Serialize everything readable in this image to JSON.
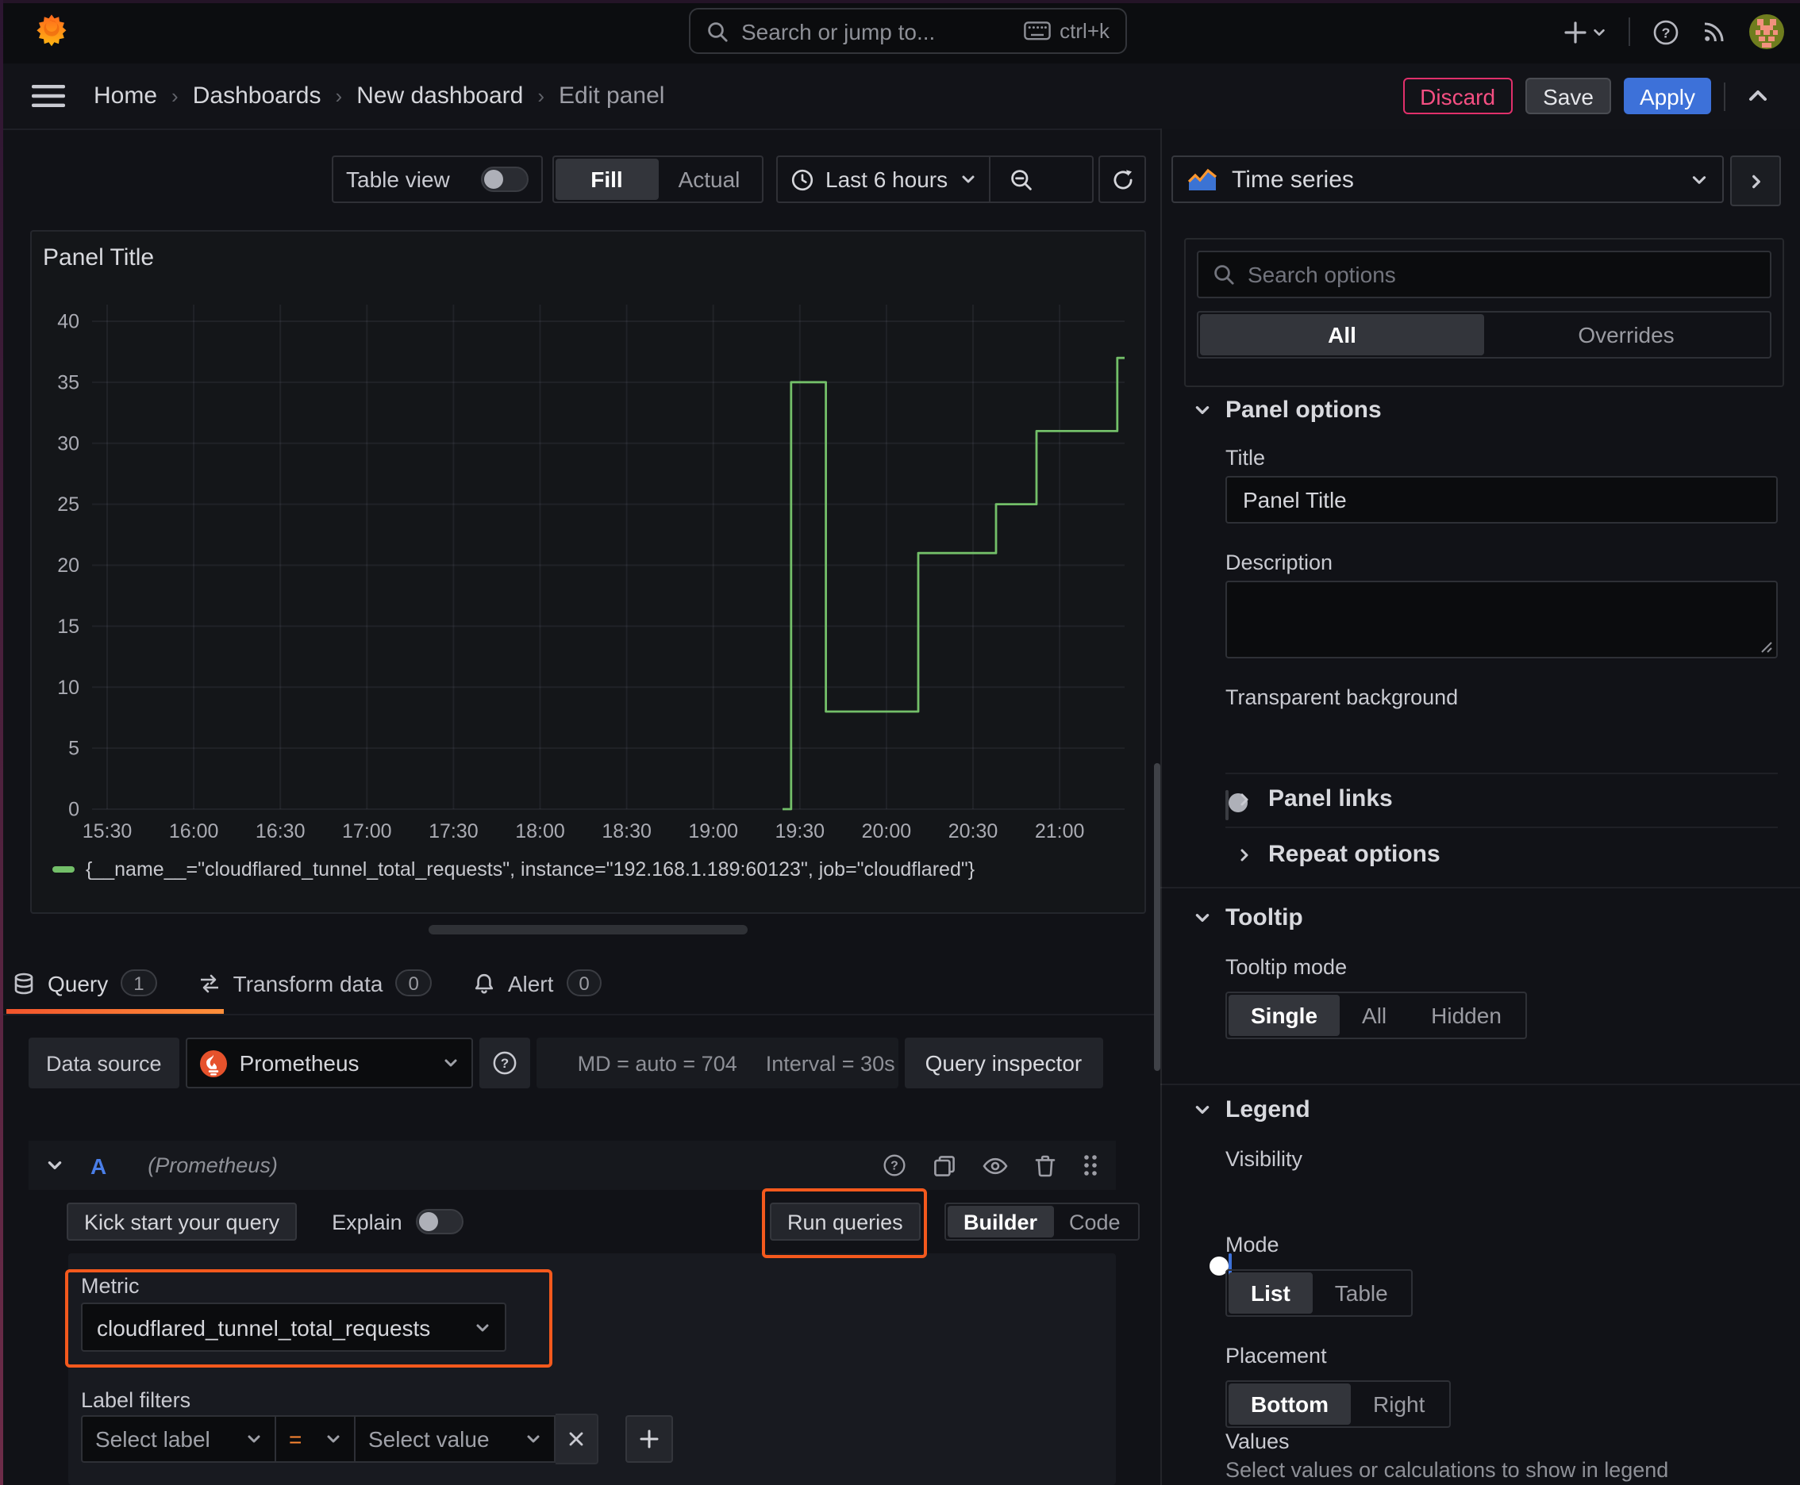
{
  "header": {
    "search_placeholder": "Search or jump to...",
    "search_shortcut": "ctrl+k"
  },
  "breadcrumb": {
    "items": [
      "Home",
      "Dashboards",
      "New dashboard",
      "Edit panel"
    ],
    "discard": "Discard",
    "save": "Save",
    "apply": "Apply"
  },
  "toolbar": {
    "table_view": "Table view",
    "fill": "Fill",
    "actual": "Actual",
    "time_range": "Last 6 hours"
  },
  "panel": {
    "title": "Panel Title"
  },
  "chart_data": {
    "type": "line",
    "title": "Panel Title",
    "x_ticks": [
      "15:30",
      "16:00",
      "16:30",
      "17:00",
      "17:30",
      "18:00",
      "18:30",
      "19:00",
      "19:30",
      "20:00",
      "20:30",
      "21:00"
    ],
    "y_ticks": [
      0,
      5,
      10,
      15,
      20,
      25,
      30,
      35,
      40
    ],
    "ylim": [
      0,
      41.3
    ],
    "x_range_minutes": [
      -5.2,
      352.5
    ],
    "grid": true,
    "legend_position": "bottom",
    "series": [
      {
        "name": "{__name__=\"cloudflared_tunnel_total_requests\", instance=\"192.168.1.189:60123\", job=\"cloudflared\"}",
        "color": "#73bf69",
        "mode": "step-after",
        "points": [
          [
            "19:24",
            0
          ],
          [
            "19:27",
            35
          ],
          [
            "19:39",
            8
          ],
          [
            "20:11",
            21
          ],
          [
            "20:38",
            25
          ],
          [
            "20:52",
            31
          ],
          [
            "21:20",
            37
          ]
        ]
      }
    ]
  },
  "tabs": {
    "query": "Query",
    "query_count": "1",
    "transform": "Transform data",
    "transform_count": "0",
    "alert": "Alert",
    "alert_count": "0"
  },
  "datasource": {
    "label": "Data source",
    "name": "Prometheus",
    "stats_md": "MD = auto = 704",
    "stats_interval": "Interval = 30s",
    "inspector": "Query inspector"
  },
  "query": {
    "ref": "A",
    "ds_hint": "(Prometheus)",
    "kickstart": "Kick start your query",
    "explain": "Explain",
    "run": "Run queries",
    "builder": "Builder",
    "code": "Code",
    "metric_label": "Metric",
    "metric_value": "cloudflared_tunnel_total_requests",
    "label_filters": "Label filters",
    "select_label": "Select label",
    "op": "=",
    "select_value": "Select value"
  },
  "options": {
    "viz": "Time series",
    "search_placeholder": "Search options",
    "tab_all": "All",
    "tab_overrides": "Overrides",
    "panel_options": "Panel options",
    "title_label": "Title",
    "title_value": "Panel Title",
    "description_label": "Description",
    "transparent": "Transparent background",
    "panel_links": "Panel links",
    "repeat": "Repeat options",
    "tooltip": "Tooltip",
    "tooltip_mode": "Tooltip mode",
    "tooltip_opts": [
      "Single",
      "All",
      "Hidden"
    ],
    "legend": "Legend",
    "visibility": "Visibility",
    "mode": "Mode",
    "mode_opts": [
      "List",
      "Table"
    ],
    "placement": "Placement",
    "placement_opts": [
      "Bottom",
      "Right"
    ],
    "values_label": "Values",
    "values_desc": "Select values or calculations to show in legend"
  }
}
